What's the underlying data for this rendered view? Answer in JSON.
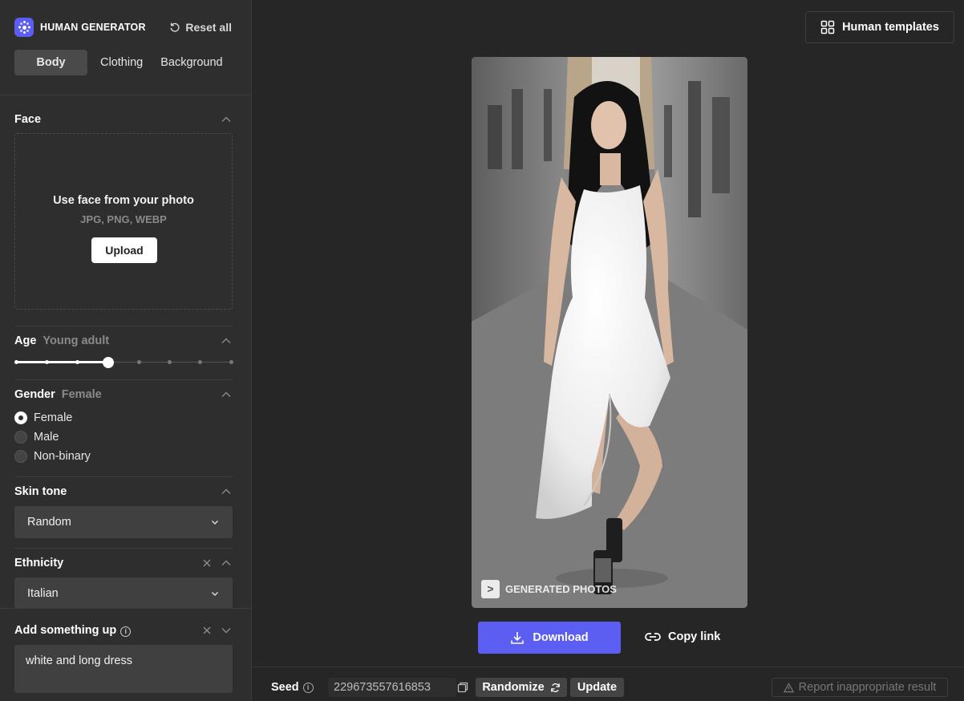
{
  "brand": {
    "name": "HUMAN GENERATOR",
    "reset_label": "Reset all"
  },
  "tabs": [
    {
      "label": "Body",
      "active": true
    },
    {
      "label": "Clothing"
    },
    {
      "label": "Background"
    }
  ],
  "face": {
    "title": "Face",
    "dropzone_title": "Use face from your photo",
    "formats": "JPG, PNG, WEBP",
    "upload_label": "Upload"
  },
  "age": {
    "title": "Age",
    "value": "Young adult",
    "steps": 8,
    "selected_index": 3
  },
  "gender": {
    "title": "Gender",
    "value": "Female",
    "options": [
      {
        "label": "Female",
        "checked": true
      },
      {
        "label": "Male"
      },
      {
        "label": "Non-binary"
      }
    ]
  },
  "skin_tone": {
    "title": "Skin tone",
    "value": "Random"
  },
  "ethnicity": {
    "title": "Ethnicity",
    "value": "Italian"
  },
  "add_something": {
    "title": "Add something up",
    "value": "white and long dress"
  },
  "main": {
    "templates_label": "Human templates",
    "watermark": "GENERATED PHOTOS",
    "watermark_glyph": ">",
    "download_label": "Download",
    "copy_link_label": "Copy link"
  },
  "seed": {
    "label": "Seed",
    "value": "229673557616853",
    "randomize_label": "Randomize",
    "update_label": "Update",
    "report_label": "Report inappropriate result"
  },
  "colors": {
    "accent": "#5b5ef0",
    "sidebar_bg": "#2e2e2e",
    "main_bg": "#262626"
  }
}
